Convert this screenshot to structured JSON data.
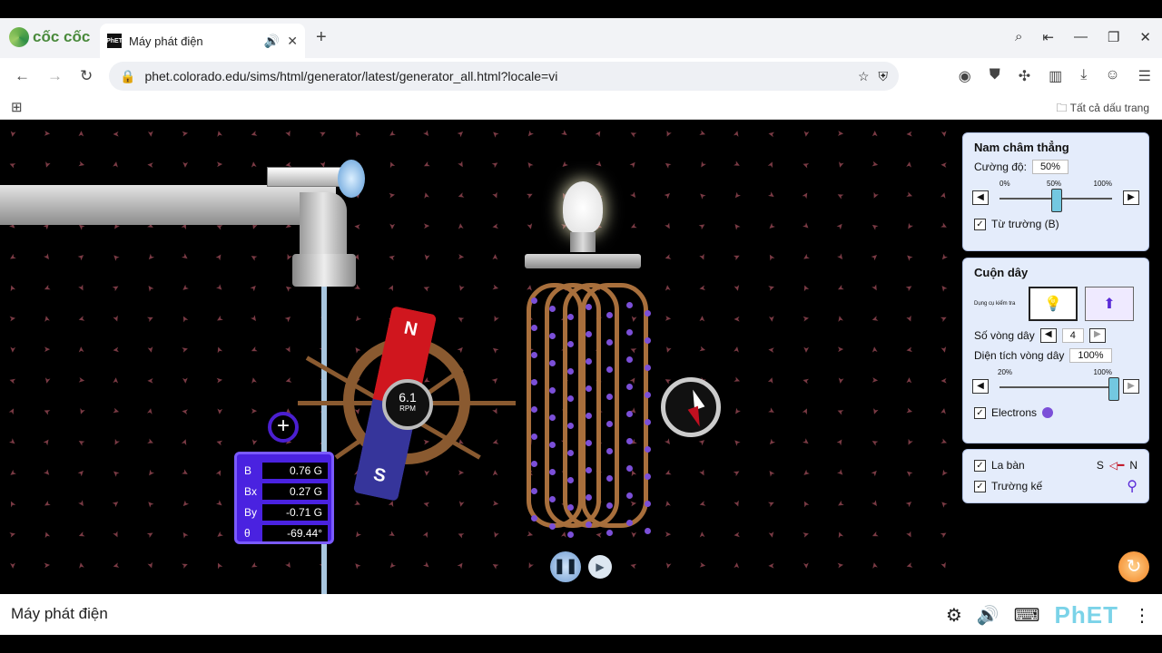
{
  "browser": {
    "brand": "cốc cốc",
    "tab_title": "Máy phát điện",
    "url": "phet.colorado.edu/sims/html/generator/latest/generator_all.html?locale=vi",
    "bookmarks_label": "Tất cả dấu trang"
  },
  "sim": {
    "rpm_value": "6.1",
    "rpm_unit": "RPM",
    "magnet": {
      "north": "N",
      "south": "S"
    },
    "probe": [
      {
        "label": "B",
        "value": "0.76 G"
      },
      {
        "label": "Bx",
        "value": "0.27 G"
      },
      {
        "label": "By",
        "value": "-0.71 G"
      },
      {
        "label": "θ",
        "value": "-69.44°"
      }
    ],
    "probe_plus": "+"
  },
  "panels": {
    "magnet": {
      "title": "Nam châm thẳng",
      "strength_label": "Cường độ:",
      "strength_value": "50%",
      "ticks": [
        "0%",
        "50%",
        "100%"
      ],
      "strength_fraction": 0.5,
      "field_label": "Từ trường (B)"
    },
    "coil": {
      "title": "Cuộn dây",
      "indicator_label": "Dụng cụ kiểm tra",
      "loops_label": "Số vòng dây",
      "loops_value": "4",
      "area_label": "Diện tích vòng dây",
      "area_value": "100%",
      "area_ticks": [
        "20%",
        "100%"
      ],
      "area_fraction": 1.0,
      "electrons_label": "Electrons"
    },
    "tools": {
      "compass_label": "La bàn",
      "compass_legend_s": "S",
      "compass_legend_n": "N",
      "fieldmeter_label": "Trường kế"
    }
  },
  "footer": {
    "sim_name": "Máy phát điện",
    "phet_logo": "PhET"
  }
}
